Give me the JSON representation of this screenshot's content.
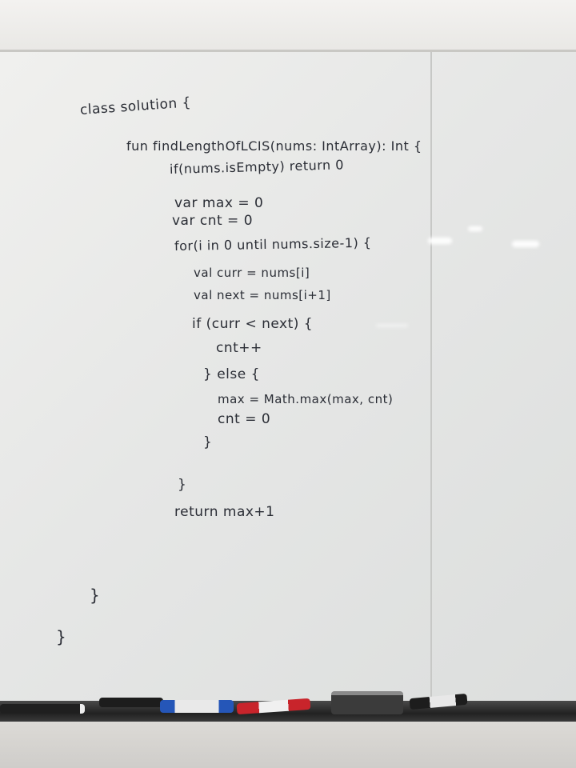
{
  "whiteboard": {
    "code_lines": [
      "class solution {",
      "fun findLengthOfLCIS(nums: IntArray): Int {",
      "if(nums.isEmpty) return 0",
      "var max = 0",
      "var cnt = 0",
      "for(i in 0 until nums.size-1) {",
      "val curr = nums[i]",
      "val next = nums[i+1]",
      "if (curr < next) {",
      "cnt++",
      "} else {",
      "max = Math.max(max, cnt)",
      "cnt = 0",
      "}",
      "}",
      "return max+1",
      "}",
      "}"
    ]
  },
  "colors": {
    "ink": "#2a2d35",
    "board": "#e8e9e7",
    "ledge": "#222222"
  },
  "tray_items": [
    "marker-black",
    "marker-blue",
    "marker-red",
    "eraser",
    "marker-black"
  ]
}
